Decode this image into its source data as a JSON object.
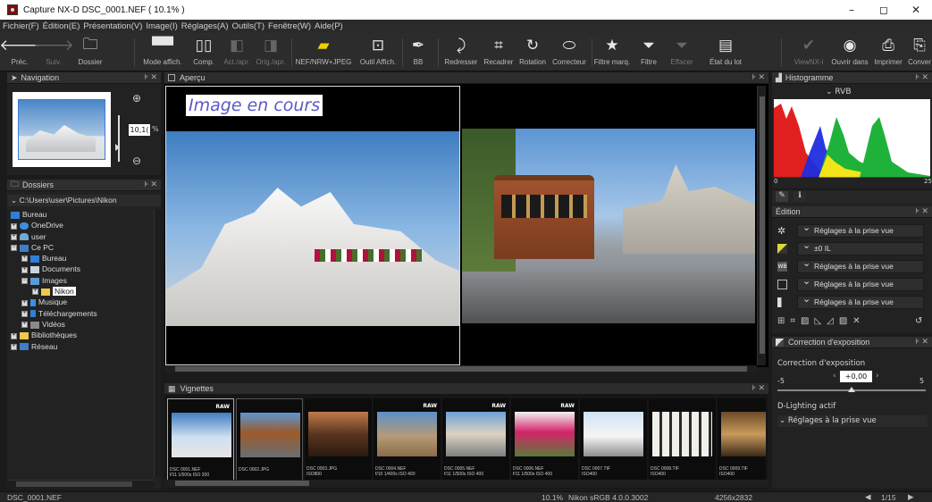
{
  "window": {
    "title": "Capture NX-D     DSC_0001.NEF ( 10.1% )",
    "controls": [
      "–",
      "◻",
      "✕"
    ]
  },
  "menu": [
    "Fichier(F)",
    "Édition(E)",
    "Présentation(V)",
    "Image(I)",
    "Réglages(A)",
    "Outils(T)",
    "Fenêtre(W)",
    "Aide(P)"
  ],
  "toolbar": {
    "prev": "Préc.",
    "next": "Suiv.",
    "folder": "Dossier",
    "view_mode": "Mode affich.",
    "compare": "Comp.",
    "before_after": "Act./apr.",
    "orig_after": "Orig./apr.",
    "nef_jpeg": "NEF/NRW+JPEG",
    "display_tool": "Outil Affich.",
    "wb": "BB",
    "straighten": "Redresser",
    "crop": "Recadrer",
    "rotate": "Rotation",
    "retouch": "Correcteur",
    "label_filter": "Filtre marq.",
    "filter": "Filtre",
    "clear": "Effacer",
    "batch_status": "État du lot",
    "viewnx": "ViewNX-i",
    "open_in": "Ouvrir dans",
    "print": "Imprimer",
    "convert": "Conver"
  },
  "navigation": {
    "title": "Navigation",
    "zoom": "10,1(",
    "zoom_unit": "%"
  },
  "folders": {
    "title": "Dossiers",
    "path": "C:\\Users\\user\\Pictures\\Nikon",
    "items": [
      {
        "label": "Bureau"
      },
      {
        "label": "OneDrive"
      },
      {
        "label": "user"
      },
      {
        "label": "Ce PC"
      },
      {
        "label": "Bureau"
      },
      {
        "label": "Documents"
      },
      {
        "label": "Images"
      },
      {
        "label": "Nikon"
      },
      {
        "label": "Musique"
      },
      {
        "label": "Téléchargements"
      },
      {
        "label": "Vidéos"
      },
      {
        "label": "Bibliothèques"
      },
      {
        "label": "Réseau"
      }
    ]
  },
  "preview": {
    "title": "Aperçu",
    "overlay": "Image en cours"
  },
  "thumbnails": {
    "title": "Vignettes",
    "items": [
      {
        "line1": "DSC 0001.NEF",
        "line2": "f/11 1/500s ISO 200",
        "raw": "RAW"
      },
      {
        "line1": "DSC 0002.JPG",
        "line2": "",
        "raw": ""
      },
      {
        "line1": "DSC 0003.JPG",
        "line2": "ISO800",
        "raw": ""
      },
      {
        "line1": "DSC 0004.NEF",
        "line2": "f/10 1/400s ISO 400",
        "raw": "RAW"
      },
      {
        "line1": "DSC 0005.NEF",
        "line2": "f/11 1/500s ISO 400",
        "raw": "RAW"
      },
      {
        "line1": "DSC 0006.NEF",
        "line2": "f/11 1/500s ISO 400",
        "raw": "RAW"
      },
      {
        "line1": "DSC 0007.TIF",
        "line2": "ISO400",
        "raw": ""
      },
      {
        "line1": "DSC 0008.TIF",
        "line2": "ISO400",
        "raw": ""
      },
      {
        "line1": "DSC 0009.TIF",
        "line2": "ISO400",
        "raw": ""
      }
    ]
  },
  "histogram": {
    "title": "Histogramme",
    "channel": "RVB",
    "min": "0",
    "max": "25"
  },
  "edit": {
    "title": "Édition",
    "rows": [
      "Réglages à la prise vue",
      "±0 IL",
      "Réglages à la prise vue",
      "Réglages à la prise vue",
      "Réglages à la prise vue"
    ]
  },
  "exposure": {
    "title": "Correction d'exposition",
    "label": "Correction d'exposition",
    "value": "+0,00",
    "min": "-5",
    "max": "5",
    "level": 0,
    "dlighting_label": "D-Lighting actif",
    "dlighting_value": "Réglages à la prise vue"
  },
  "status": {
    "file": "DSC_0001.NEF",
    "zoom": "10.1%",
    "profile": "Nikon sRGB 4.0.0.3002",
    "dimensions": "4256x2832",
    "page": "1/15"
  }
}
